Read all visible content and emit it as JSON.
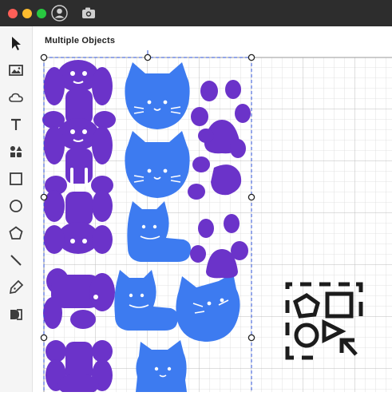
{
  "window": {
    "traffic_lights": {
      "close": "#ff5f57",
      "minimize": "#febc2e",
      "zoom": "#28c840"
    },
    "titlebar_icons": [
      "user-circle-icon",
      "camera-icon"
    ]
  },
  "toolbar": {
    "tools": [
      "pointer-icon",
      "image-icon",
      "cloud-icon",
      "text-icon",
      "shapes-icon",
      "square-icon",
      "circle-icon",
      "pentagon-icon",
      "line-icon",
      "pen-icon",
      "combine-icon"
    ]
  },
  "selection": {
    "label": "Multiple Objects"
  },
  "colors": {
    "purple": "#6b33c9",
    "blue": "#3d7bf0",
    "grid": "#d7d7d7",
    "accent": "#2b4fd6"
  },
  "badge": {
    "icon": "multiple-selection-icon"
  }
}
